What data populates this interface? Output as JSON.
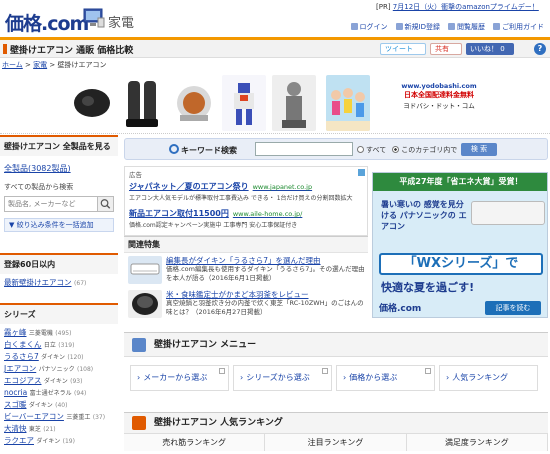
{
  "header": {
    "logo": "価格.com",
    "category": "家電",
    "pr_tag": "[PR]",
    "pr_text": "7月12日（火）衝撃のamazonプライムデー！",
    "links": [
      "ログイン",
      "新規ID登録",
      "閲覧履歴",
      "ご利用ガイド"
    ]
  },
  "title_bar": {
    "title": "壁掛けエアコン 通販 価格比較",
    "tweet": "ツイート",
    "share": "共有",
    "like": "いいね！ 0",
    "help": "?"
  },
  "breadcrumb": [
    "ホーム",
    "家電",
    "壁掛けエアコン"
  ],
  "ad_banner": {
    "url": "www.yodobashi.com",
    "line1": "日本全国配達料金無料",
    "line2": "ヨドバシ・ドット・コム"
  },
  "sidebar": {
    "heading": "壁掛けエアコン 全製品を見る",
    "all_link": "全製品(3082製品)",
    "search_label": "すべての製品から検索",
    "search_placeholder": "製品名, メーカーなど",
    "refine": "▼ 絞り込み条件を一括追加",
    "recent_heading": "登録60日以内",
    "recent_link": "最新壁掛けエアコン",
    "recent_count": "(67)",
    "series_heading": "シリーズ",
    "series": [
      {
        "name": "霧ヶ峰",
        "maker": "三菱電機",
        "count": "(495)"
      },
      {
        "name": "白くまくん",
        "maker": "日立",
        "count": "(319)"
      },
      {
        "name": "うるさら7",
        "maker": "ダイキン",
        "count": "(120)"
      },
      {
        "name": "Jエアコン",
        "maker": "パナソニック",
        "count": "(108)"
      },
      {
        "name": "エコジアス",
        "maker": "ダイキン",
        "count": "(93)"
      },
      {
        "name": "nocria",
        "maker": "富士通ゼネラル",
        "count": "(94)"
      },
      {
        "name": "スゴ暖",
        "maker": "ダイキン",
        "count": "(40)"
      },
      {
        "name": "ビーバーエアコン",
        "maker": "三菱重工",
        "count": "(37)"
      },
      {
        "name": "大清快",
        "maker": "東芝",
        "count": "(21)"
      },
      {
        "name": "ラクエア",
        "maker": "ダイキン",
        "count": "(19)"
      }
    ]
  },
  "keyword_search": {
    "label": "キーワード検索",
    "radio_all": "すべて",
    "radio_category": "このカテゴリ内で",
    "button": "検 索"
  },
  "ads": {
    "heading": "広告",
    "items": [
      {
        "title": "ジャパネット／夏のエアコン祭り",
        "url": "www.japanet.co.jp",
        "desc": "エアコン大人気モデルが標準取付工事費込み できる・ 1台だけ買えの分割回数拡大"
      },
      {
        "title": "新品エアコン取付11500円",
        "url": "www.aile-home.co.jp/",
        "desc": "価格.com認定キャンペーン実施中 工事専門 安心工事保証付き"
      }
    ]
  },
  "related": {
    "heading": "関連特集",
    "items": [
      {
        "title": "編集長がダイキン「うるさら7」を選んだ理由",
        "desc": "価格.com編集長も使用するダイキン「うるさら7」。その選んだ理由を本人が語る（2016年6月1日掲載）"
      },
      {
        "title": "米・食味鑑定士がかまど本羽釜をレビュー",
        "desc": "真空焼鍋と羽釜炊き分の内釜で炊く東芝「RC-10ZWH」のごはんの味とは？（2016年6月27日掲載）"
      }
    ]
  },
  "banner": {
    "top": "平成27年度「省エネ大賞」受賞！",
    "copy": "暑い寒いの 感覚を見分ける パナソニックの エアコン",
    "series": "「WXシリーズ」で",
    "sub": "快適な夏を過ごす!",
    "logo": "価格.com",
    "button": "記事を読む"
  },
  "menu": {
    "heading": "壁掛けエアコン メニュー",
    "items": [
      "メーカーから選ぶ",
      "シリーズから選ぶ",
      "価格から選ぶ",
      "人気ランキング"
    ]
  },
  "ranking": {
    "heading": "壁掛けエアコン 人気ランキング",
    "tabs": [
      "売れ筋ランキング",
      "注目ランキング",
      "満足度ランキング"
    ]
  },
  "colors": {
    "accent": "#f39800",
    "link": "#1a44a8",
    "brand": "#1d3c8f"
  }
}
